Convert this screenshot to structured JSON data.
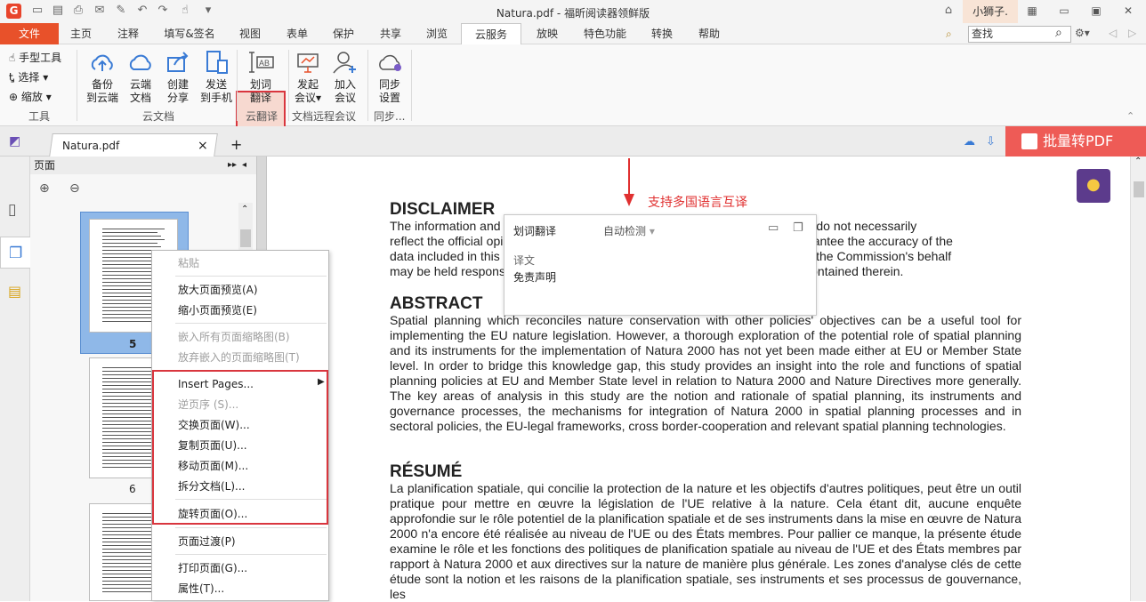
{
  "title_bar": {
    "logo": "G",
    "title": "Natura.pdf - 福昕阅读器领鲜版",
    "user": "小狮子."
  },
  "menu": {
    "tabs": [
      "文件",
      "主页",
      "注释",
      "填写&签名",
      "视图",
      "表单",
      "保护",
      "共享",
      "浏览",
      "云服务",
      "放映",
      "特色功能",
      "转换",
      "帮助"
    ],
    "active": "云服务",
    "search_value": "查找"
  },
  "ribbon": {
    "tools_small": [
      "手型工具",
      "选择",
      "缩放"
    ],
    "group_tools": "工具",
    "backup": [
      "备份",
      "到云端"
    ],
    "cloud_docs": [
      "云端",
      "文档"
    ],
    "create_share": [
      "创建",
      "分享"
    ],
    "send_phone": [
      "发送",
      "到手机"
    ],
    "group_cloud_doc": "云文档",
    "translate": [
      "划词",
      "翻译"
    ],
    "group_translate": "云翻译",
    "start_meeting": [
      "发起",
      "会议"
    ],
    "join_meeting": [
      "加入",
      "会议"
    ],
    "group_meeting": "文档远程会议",
    "sync_settings": [
      "同步",
      "设置"
    ],
    "group_sync": "同步..."
  },
  "doc_tab": {
    "name": "Natura.pdf",
    "close": "×",
    "new": "+"
  },
  "batch_pdf": "批量转PDF",
  "pages_panel": {
    "title": "页面",
    "page_labels": [
      "5",
      "6"
    ]
  },
  "context_menu": {
    "paste": "粘贴",
    "zoom_in_preview": "放大页面预览(A)",
    "zoom_out_preview": "缩小页面预览(E)",
    "embed_all": "嵌入所有页面缩略图(B)",
    "discard_embedded": "放弃嵌入的页面缩略图(T)",
    "insert_pages": "Insert Pages...",
    "reverse_order": "逆页序 (S)...",
    "swap_pages": "交换页面(W)...",
    "copy_pages": "复制页面(U)...",
    "move_pages": "移动页面(M)...",
    "split_doc": "拆分文档(L)...",
    "rotate_pages": "旋转页面(O)...",
    "page_transition": "页面过渡(P)",
    "print_pages": "打印页面(G)...",
    "properties": "属性(T)..."
  },
  "annotation": "支持多国语言互译",
  "translate_popup": {
    "title": "划词翻译",
    "detect": "自动检测",
    "label": "译文",
    "result": "免责声明"
  },
  "document": {
    "disclaimer_heading": "DISCLAIMER",
    "disclaimer_lines": [
      "The information and views set out in this study are those of the author(s) and do not necessarily",
      "reflect the official opinion of the Commission. The Commission does not guarantee the accuracy of the",
      "data included in this study. Neither the Commission nor any person acting on the Commission's behalf",
      "may be held responsible for the use which may be made of the information contained therein."
    ],
    "abstract_heading": "ABSTRACT",
    "abstract_text": "Spatial planning which reconciles nature conservation with other policies' objectives can be a useful tool for implementing the EU nature legislation. However, a thorough exploration of the potential role of spatial planning and its instruments for the implementation of Natura 2000 has not yet been made either at EU or Member State level. In order to bridge this knowledge gap, this study provides an insight into the role and functions of spatial planning policies at EU and Member State level in relation to Natura 2000 and Nature Directives more generally. The key areas of analysis in this study are the notion and rationale of spatial planning, its instruments and governance processes, the mechanisms for integration of Natura 2000 in spatial planning processes and in sectoral policies, the EU-legal frameworks, cross border-cooperation and relevant spatial planning technologies.",
    "resume_heading": "RÉSUMÉ",
    "resume_text": "La planification spatiale, qui concilie la protection de la nature et les objectifs d'autres politiques, peut être un outil pratique pour mettre en œuvre la législation de l'UE relative à la nature. Cela étant dit, aucune enquête approfondie sur le rôle potentiel de la planification spatiale et de ses instruments dans la mise en œuvre de Natura 2000 n'a encore été réalisée au niveau de l'UE ou des États membres. Pour pallier ce manque, la présente étude examine le rôle et les fonctions des politiques de planification spatiale au niveau de l'UE et des États membres par rapport à Natura 2000 et aux directives sur la nature de manière plus générale. Les zones d'analyse clés de cette étude sont la notion et les raisons de la planification spatiale, ses instruments et ses processus de gouvernance, les"
  },
  "colors": {
    "accent": "#e8512a",
    "highlight_box": "#d9363e",
    "batch_btn": "#ee5b56"
  }
}
